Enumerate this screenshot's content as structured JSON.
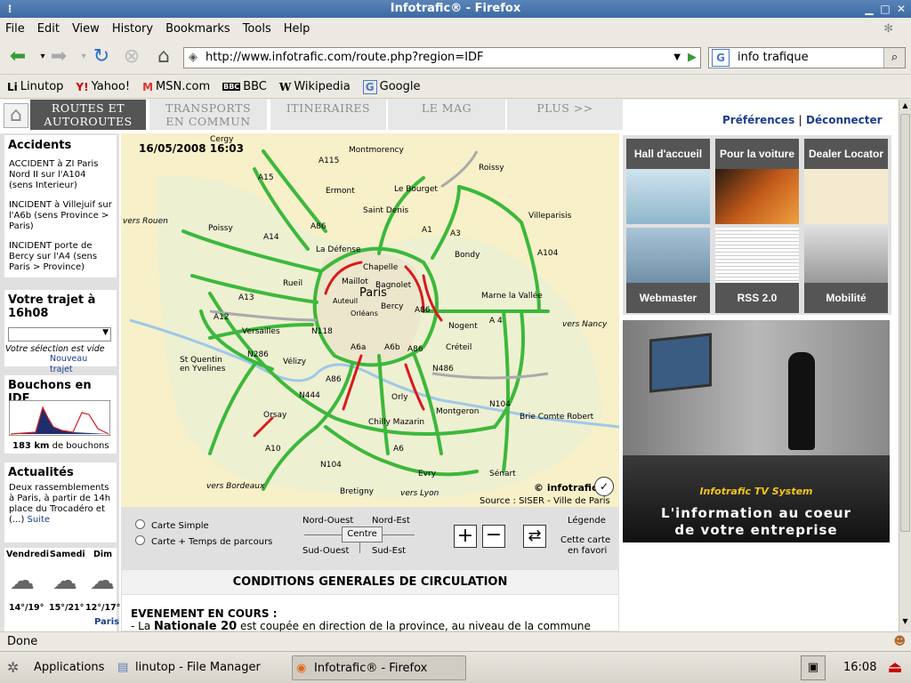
{
  "window": {
    "title": "Infotrafic® - Firefox"
  },
  "menu": [
    "File",
    "Edit",
    "View",
    "History",
    "Bookmarks",
    "Tools",
    "Help"
  ],
  "nav": {
    "url": "http://www.infotrafic.com/route.php?region=IDF",
    "search": "info trafique"
  },
  "bookmarks": [
    {
      "icon": "Li",
      "label": "Linutop"
    },
    {
      "icon": "Y!",
      "label": "Yahoo!"
    },
    {
      "icon": "M",
      "label": "MSN.com"
    },
    {
      "icon": "BBC",
      "label": "BBC"
    },
    {
      "icon": "W",
      "label": "Wikipedia"
    },
    {
      "icon": "G",
      "label": "Google"
    }
  ],
  "tabs": [
    {
      "l1": "ROUTES ET",
      "l2": "AUTOROUTES"
    },
    {
      "l1": "TRANSPORTS",
      "l2": "EN COMMUN"
    },
    {
      "l1": "ITINERAIRES",
      "l2": ""
    },
    {
      "l1": "LE MAG",
      "l2": ""
    },
    {
      "l1": "PLUS >>",
      "l2": ""
    }
  ],
  "header_links": {
    "prefs": "Préférences",
    "sep": "|",
    "logout": "Déconnecter"
  },
  "accidents": {
    "title": "Accidents",
    "items": [
      "ACCIDENT à ZI Paris Nord II sur l'A104 (sens Interieur)",
      "INCIDENT à Villejuif sur l'A6b (sens Province > Paris)",
      "INCIDENT porte de Bercy sur l'A4 (sens Paris > Province)"
    ]
  },
  "trajet": {
    "title": "Votre trajet à 16h08",
    "empty": "Votre sélection est vide",
    "new": "Nouveau trajet"
  },
  "bouchons": {
    "title": "Bouchons en IDF",
    "value": "183 km",
    "suffix": "de bouchons"
  },
  "actualites": {
    "title": "Actualités",
    "text": "Deux rassemblements à Paris, à partir de 14h place du Trocadéro et (...)",
    "more": "Suite"
  },
  "weather": {
    "days": [
      "Vendredi",
      "Samedi",
      "Dim"
    ],
    "temps": [
      "14°/19°",
      "15°/21°",
      "12°/17°"
    ],
    "city": "Paris"
  },
  "map": {
    "timestamp": "16/05/2008 16:03",
    "brand": "© infotrafic",
    "source": "Source : SISER - Ville de Paris",
    "places": [
      "Cergy",
      "Montmorency",
      "Roissy",
      "A115",
      "A15",
      "Ermont",
      "Le Bourget",
      "Saint Denis",
      "Villeparisis",
      "vers Rouen",
      "Poissy",
      "A14",
      "A86",
      "La Défense",
      "A1",
      "A3",
      "Bondy",
      "A104",
      "Chapelle",
      "Maillot",
      "Paris",
      "Bagnolet",
      "Rueil",
      "A13",
      "Auteuil",
      "Orléans",
      "Bercy",
      "A86",
      "Marne la Vallée",
      "A12",
      "Versailles",
      "N118",
      "A6a",
      "A6b",
      "A86",
      "Nogent",
      "A 4",
      "vers Nancy",
      "St Quentin",
      "en Yvelines",
      "N286",
      "Vélizy",
      "Créteil",
      "N486",
      "A86",
      "Orly",
      "N444",
      "Orsay",
      "Chilly Mazarin",
      "Montgeron",
      "N104",
      "Brie Comte Robert",
      "A10",
      "A6",
      "N104",
      "vers Bordeaux",
      "Bretigny",
      "Evry",
      "Sénart",
      "vers Lyon"
    ]
  },
  "controls": {
    "simple": "Carte Simple",
    "temps": "Carte + Temps de parcours",
    "nw": "Nord-Ouest",
    "ne": "Nord-Est",
    "centre": "Centre",
    "sw": "Sud-Ouest",
    "se": "Sud-Est",
    "legend": "Légende",
    "fav1": "Cette carte",
    "fav2": "en favori"
  },
  "conditions": {
    "title": "CONDITIONS GENERALES DE CIRCULATION",
    "event": "EVENEMENT EN COURS :",
    "text_pre": "- La ",
    "text_bold": "Nationale 20",
    "text_post": " est coupée en direction de la province, au niveau de la commune"
  },
  "tiles": [
    "Hall d'accueil",
    "Pour la voiture",
    "Dealer Locator",
    "Webmaster",
    "RSS 2.0",
    "Mobilité"
  ],
  "promo": {
    "brand": "Infotrafic TV System",
    "line1": "L'information au coeur",
    "line2": "de votre entreprise"
  },
  "status": "Done",
  "taskbar": {
    "apps": "Applications",
    "fm": "linutop - File Manager",
    "ff": "Infotrafic® - Firefox",
    "clock": "16:08"
  },
  "colors": {
    "tab_active": "#555555",
    "link": "#1a3d8f",
    "road_ok": "#3cb83c",
    "road_jam": "#d81a1a"
  }
}
